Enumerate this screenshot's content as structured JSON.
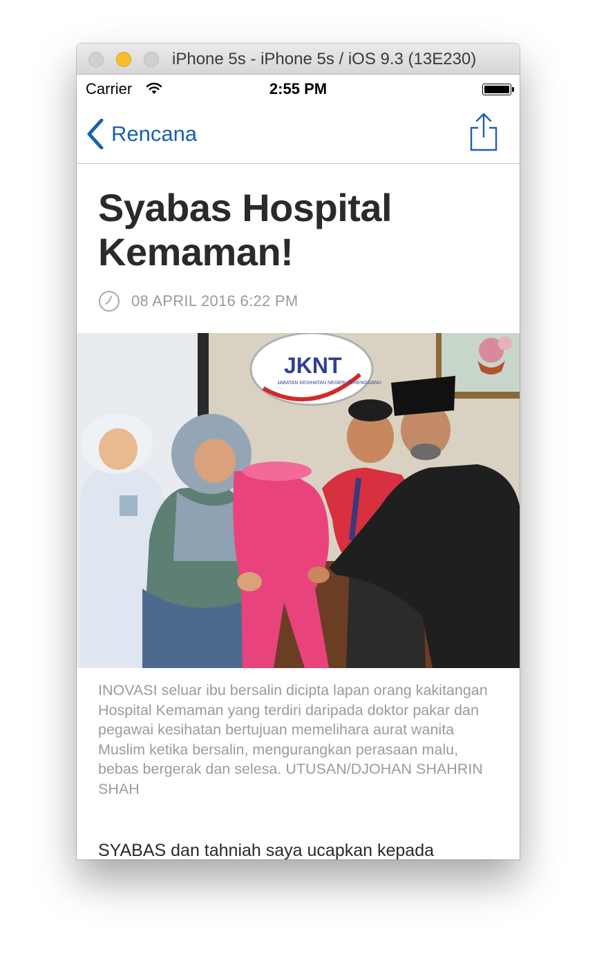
{
  "window": {
    "title": "iPhone 5s - iPhone 5s / iOS 9.3 (13E230)"
  },
  "status_bar": {
    "carrier": "Carrier",
    "time": "2:55 PM",
    "battery_level": 1.0
  },
  "nav": {
    "back_label": "Rencana",
    "accent_color": "#1a5fb4"
  },
  "article": {
    "title": "Syabas Hospital Kemaman!",
    "date": "08 APRIL 2016 6:22 PM",
    "photo_logo_text": "JKNT",
    "photo_logo_subtext": "JABATAN KESIHATAN NEGERI TERENGGANU",
    "caption": "INOVASI seluar ibu bersalin dicipta lapan orang kakitangan Hospital Kemaman yang terdiri daripada doktor pakar dan pegawai kesihatan bertujuan memelihara aurat wanita Muslim ketika bersalin, mengurangkan perasaan malu, bebas bergerak dan selesa.  UTUSAN/DJOHAN SHAHRIN SHAH",
    "body_start": "SYABAS dan tahniah saya ucapkan kepada"
  },
  "icons": {
    "back": "chevron-left-icon",
    "share": "share-icon",
    "clock": "clock-icon",
    "wifi": "wifi-icon",
    "battery": "battery-icon"
  }
}
